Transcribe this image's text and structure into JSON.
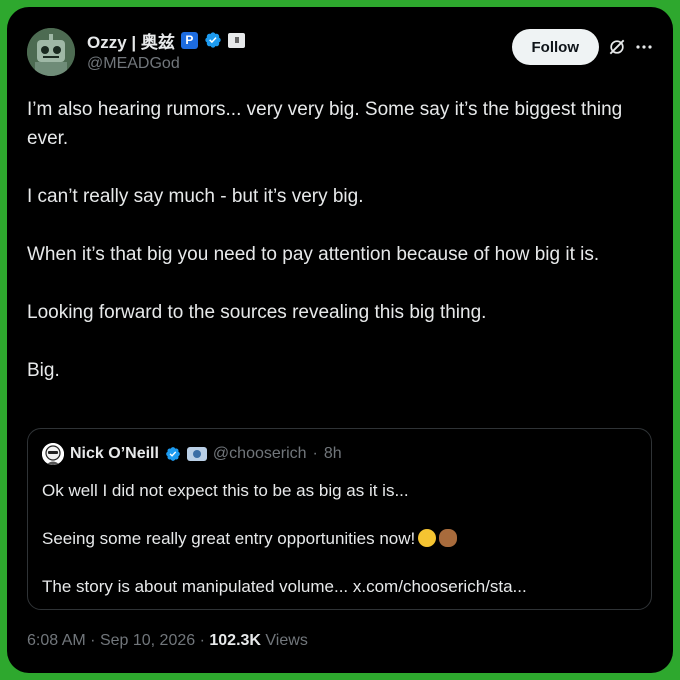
{
  "author": {
    "display_name": "Ozzy | 奥兹",
    "handle": "@MEADGod",
    "badge_letter": "P",
    "verified": true,
    "avatar_icon": "robot-avatar-icon"
  },
  "actions": {
    "follow_label": "Follow",
    "grok_icon": "grok-icon",
    "more_icon": "more-icon"
  },
  "tweet": {
    "paragraphs": [
      "I’m also hearing rumors... very very big. Some say it’s the biggest thing ever.",
      "I can’t really say much - but it’s very big.",
      "When it’s that big you need to pay attention because of how big it is.",
      "Looking forward to the sources revealing this big thing.",
      "Big."
    ]
  },
  "quote": {
    "display_name": "Nick O’Neill",
    "handle": "@chooserich",
    "separator": "·",
    "time": "8h",
    "verified": true,
    "lines": [
      "Ok well I did not expect this to be as big as it is...",
      "Seeing some really great entry opportunities now!",
      "The story is about manipulated volume... x.com/chooserich/sta..."
    ],
    "emojis": [
      "grinning-sweat-emoji",
      "see-no-evil-monkey-emoji"
    ]
  },
  "meta": {
    "time": "6:08 AM",
    "separator": "·",
    "date": "Sep 10, 2026",
    "views_count": "102.3K",
    "views_label": "Views"
  },
  "colors": {
    "border_green": "#2ea82e",
    "background": "#000000",
    "text": "#e7e9ea",
    "muted": "#71767b",
    "verified_blue": "#1d9bf0"
  }
}
